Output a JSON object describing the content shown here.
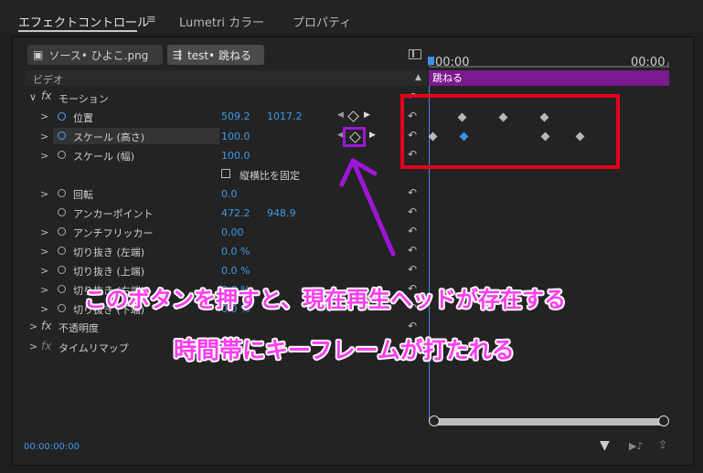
{
  "tabs": [
    {
      "label": "エフェクトコントロール"
    },
    {
      "label": "≡"
    },
    {
      "label": "Lumetri カラー"
    },
    {
      "label": "プロパティ"
    }
  ],
  "sources": {
    "source_label": "ソース• ひよこ.png",
    "sequence_label": "test• 跳ねる"
  },
  "timeline": {
    "time_start": "00:00",
    "time_end": "00:00",
    "clip_name": "跳ねる",
    "clip_color": "#7a1a8e"
  },
  "section": {
    "video": "ビデオ"
  },
  "motion": {
    "label": "モーション",
    "position": {
      "label": "位置",
      "x": "509.2",
      "y": "1017.2"
    },
    "scale_h": {
      "label": "スケール (高さ)",
      "value": "100.0"
    },
    "scale_w": {
      "label": "スケール (幅)",
      "value": "100.0"
    },
    "uniform": {
      "label": "縦横比を固定"
    },
    "rotation": {
      "label": "回転",
      "value": "0.0"
    },
    "anchor": {
      "label": "アンカーポイント",
      "x": "472.2",
      "y": "948.9"
    },
    "antiflicker": {
      "label": "アンチフリッカー",
      "value": "0.00"
    },
    "crop_left": {
      "label": "切り抜き (左端)",
      "value": "0.0 %"
    },
    "crop_top": {
      "label": "切り抜き (上端)",
      "value": "0.0 %"
    },
    "crop_right": {
      "label": "切り抜き (右端)",
      "value": "0.0 %"
    },
    "crop_bottom": {
      "label": "切り抜き (下端)",
      "value": "0.0 %"
    }
  },
  "opacity": {
    "label": "不透明度",
    "fx": "fx"
  },
  "timeremap": {
    "label": "タイムリマップ",
    "fx": "fx"
  },
  "footer": {
    "timecode": "00:00:00:00"
  },
  "annotation": {
    "line1": "このボタンを押すと、現在再生ヘッドが存在する",
    "line2": "時間帯にキーフレームが打たれる",
    "red_color": "#e4001a",
    "purple_color": "#9d16d8",
    "text_color": "#ff3df0"
  },
  "colors": {
    "value_blue": "#3e9ae8"
  }
}
